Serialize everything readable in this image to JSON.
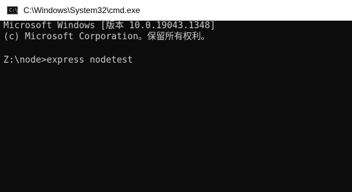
{
  "window": {
    "title": "C:\\Windows\\System32\\cmd.exe",
    "icon": "console-icon",
    "icon_glyph": "C:\\",
    "console_background": "#0c0c0c",
    "console_text_color": "#cccccc"
  },
  "console": {
    "lines": [
      "Microsoft Windows [版本 10.0.19043.1348]",
      "(c) Microsoft Corporation。保留所有权利。",
      "",
      "Z:\\node>express nodetest"
    ]
  }
}
